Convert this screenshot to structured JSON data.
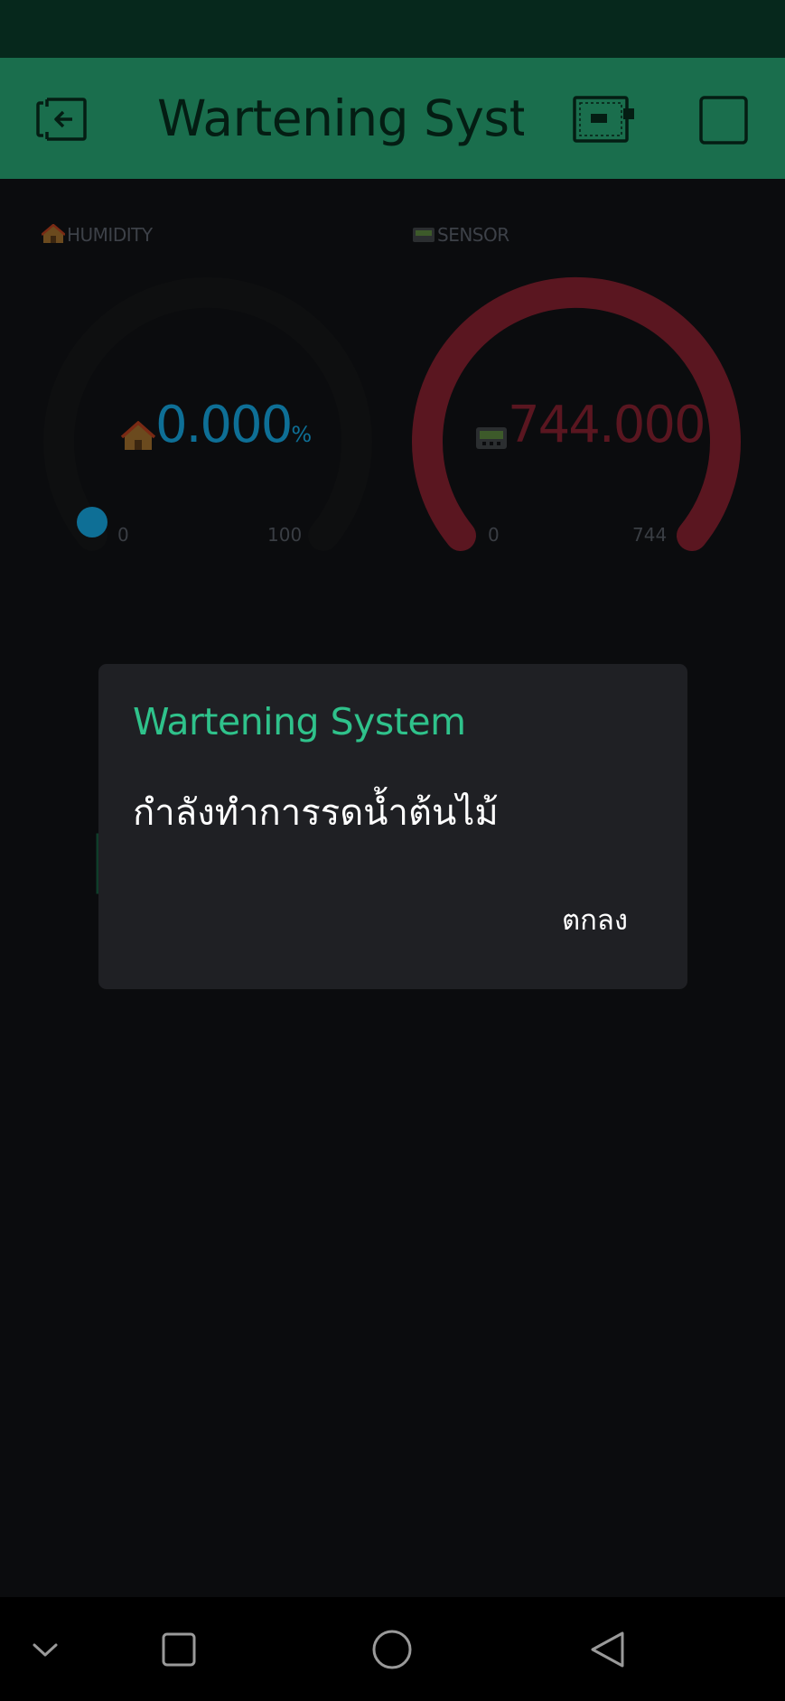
{
  "header": {
    "title": "Wartening System",
    "back_icon": "exit-icon",
    "device_icon": "device-icon",
    "square_icon": "square-icon"
  },
  "widgets": {
    "humidity": {
      "label": "HUMIDITY",
      "label_icon": "house-icon",
      "value": "0.000",
      "unit": "%",
      "min": "0",
      "max": "100",
      "level": 0.0,
      "color": "#0e6f96"
    },
    "sensor": {
      "label": "SENSOR",
      "label_icon": "pager-icon",
      "value": "744.000",
      "min": "0",
      "max": "744",
      "level": 1.0,
      "color": "#5a1620"
    }
  },
  "dialog": {
    "title": "Wartening System",
    "message": "กำลังทำการรดน้ำต้นไม้",
    "ok_label": "ตกลง"
  },
  "nav": {
    "items": [
      "chevron-down-icon",
      "recents-icon",
      "home-icon",
      "back-icon"
    ]
  },
  "colors": {
    "accent": "#2fc28b",
    "header": "#1a6e4d",
    "status_bar": "#06281c",
    "background": "#0b0c0e",
    "dialog": "#1f2024"
  }
}
